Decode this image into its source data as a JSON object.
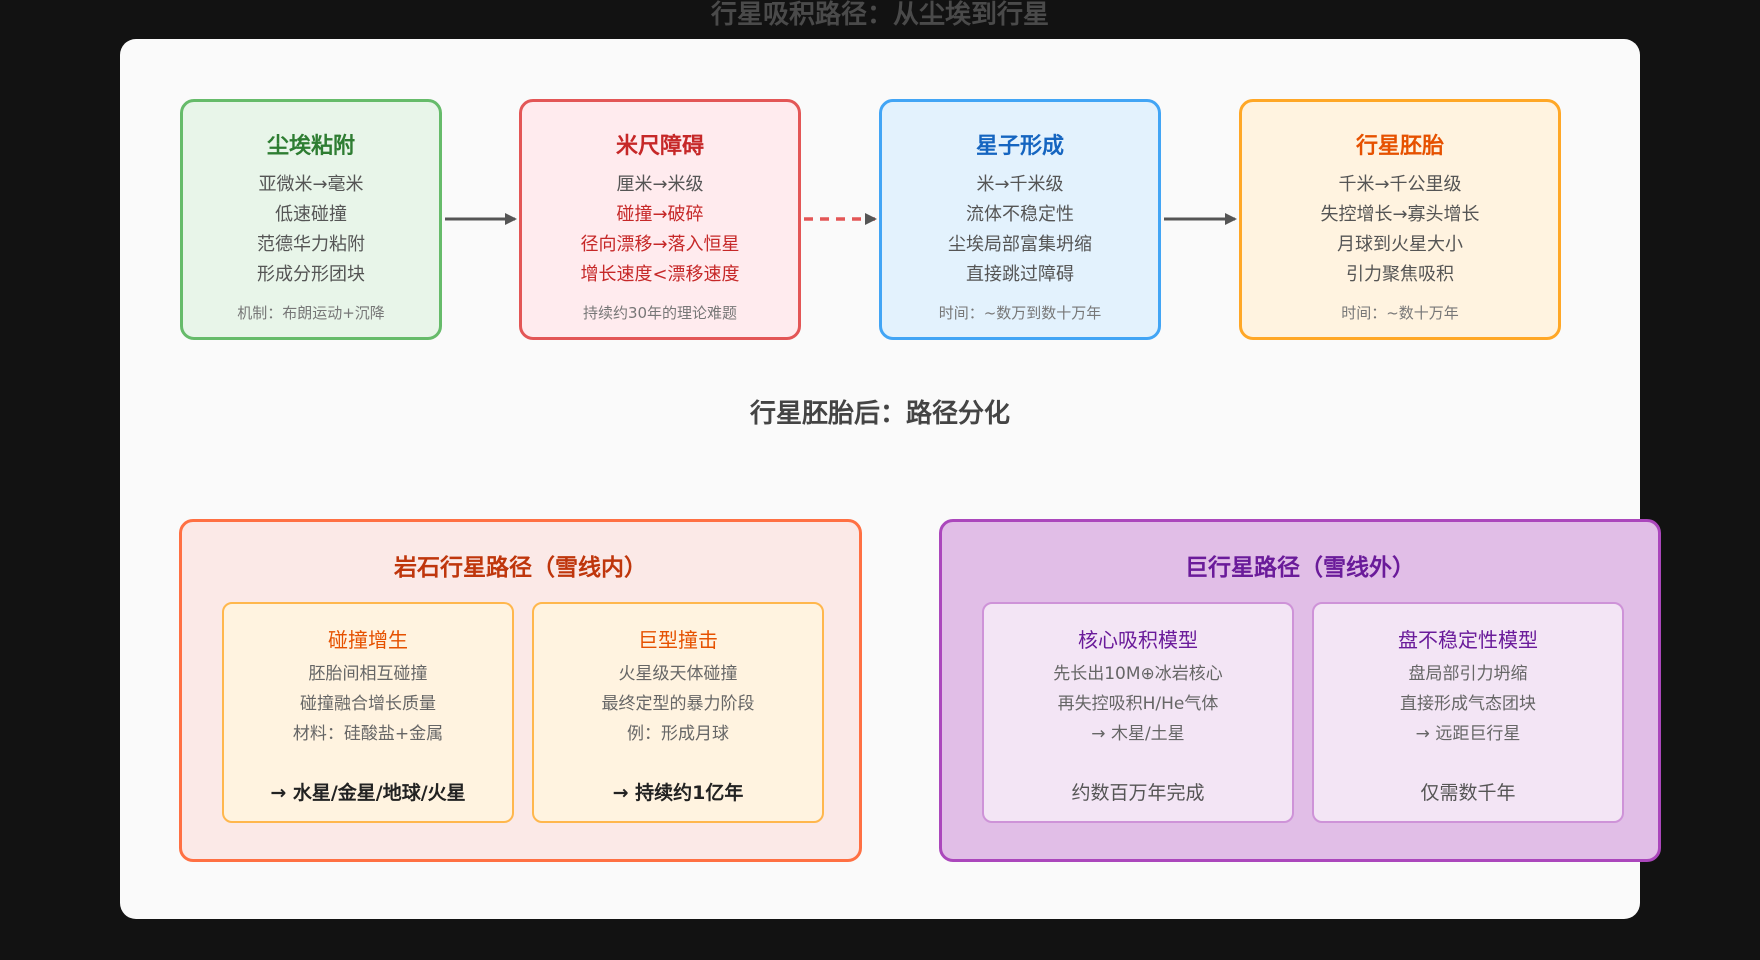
{
  "title": "行星吸积路径：从尘埃到行星",
  "stages": [
    {
      "title": "尘埃粘附",
      "lines": [
        "亚微米→毫米",
        "低速碰撞",
        "范德华力粘附",
        "形成分形团块"
      ],
      "note": "机制：布朗运动+沉降"
    },
    {
      "title": "米尺障碍",
      "lines": [
        "厘米→米级",
        "碰撞→破碎",
        "径向漂移→落入恒星",
        "增长速度<漂移速度"
      ],
      "note": "持续约30年的理论难题"
    },
    {
      "title": "星子形成",
      "lines": [
        "米→千米级",
        "流体不稳定性",
        "尘埃局部富集坍缩",
        "直接跳过障碍"
      ],
      "note": "时间：~数万到数十万年"
    },
    {
      "title": "行星胚胎",
      "lines": [
        "千米→千公里级",
        "失控增长→寡头增长",
        "月球到火星大小",
        "引力聚焦吸积"
      ],
      "note": "时间：~数十万年"
    }
  ],
  "section_title": "行星胚胎后：路径分化",
  "rocky": {
    "title": "岩石行星路径（雪线内）",
    "subs": [
      {
        "title": "碰撞增生",
        "lines": [
          "胚胎间相互碰撞",
          "碰撞融合增长质量",
          "材料：硅酸盐+金属"
        ],
        "result": "→ 水星/金星/地球/火星"
      },
      {
        "title": "巨型撞击",
        "lines": [
          "火星级天体碰撞",
          "最终定型的暴力阶段",
          "例：形成月球"
        ],
        "result": "→ 持续约1亿年"
      }
    ]
  },
  "giant": {
    "title": "巨行星路径（雪线外）",
    "subs": [
      {
        "title": "核心吸积模型",
        "lines": [
          "先长出10M⊕冰岩核心",
          "再失控吸积H/He气体",
          "→ 木星/土星"
        ],
        "result": "约数百万年完成"
      },
      {
        "title": "盘不稳定性模型",
        "lines": [
          "盘局部引力坍缩",
          "直接形成气态团块",
          "→ 远距巨行星"
        ],
        "result": "仅需数千年"
      }
    ]
  },
  "colors": {
    "green": "#66bb6a",
    "red": "#e35656",
    "blue": "#42a5f5",
    "orange": "#ffa726",
    "rock": "#ff7043",
    "giant": "#ab47bc",
    "arrow": "#555555",
    "dashed_arrow": "#e35656"
  }
}
